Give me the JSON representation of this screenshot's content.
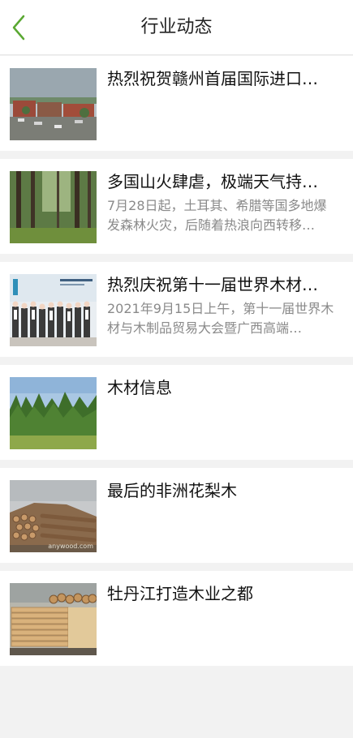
{
  "header": {
    "title": "行业动态",
    "back_icon": "chevron-left-icon",
    "accent": "#5aa832"
  },
  "articles": [
    {
      "title": "热烈祝贺赣州首届国际进口…",
      "summary": "",
      "thumb": "industrial-park-photo"
    },
    {
      "title": "多国山火肆虐，极端天气持…",
      "summary": "7月28日起，土耳其、希腊等国多地爆发森林火灾，后随着热浪向西转移…",
      "thumb": "forest-photo"
    },
    {
      "title": "热烈庆祝第十一届世界木材…",
      "summary": "2021年9月15日上午，第十一届世界木材与木制品贸易大会暨广西高端…",
      "thumb": "conference-group-photo"
    },
    {
      "title": "木材信息",
      "summary": "",
      "thumb": "tree-line-photo"
    },
    {
      "title": "最后的非洲花梨木",
      "summary": "",
      "thumb": "log-pile-photo"
    },
    {
      "title": "牡丹江打造木业之都",
      "summary": "",
      "thumb": "lumber-stack-photo"
    }
  ],
  "thumb_watermark": "anywood.com"
}
